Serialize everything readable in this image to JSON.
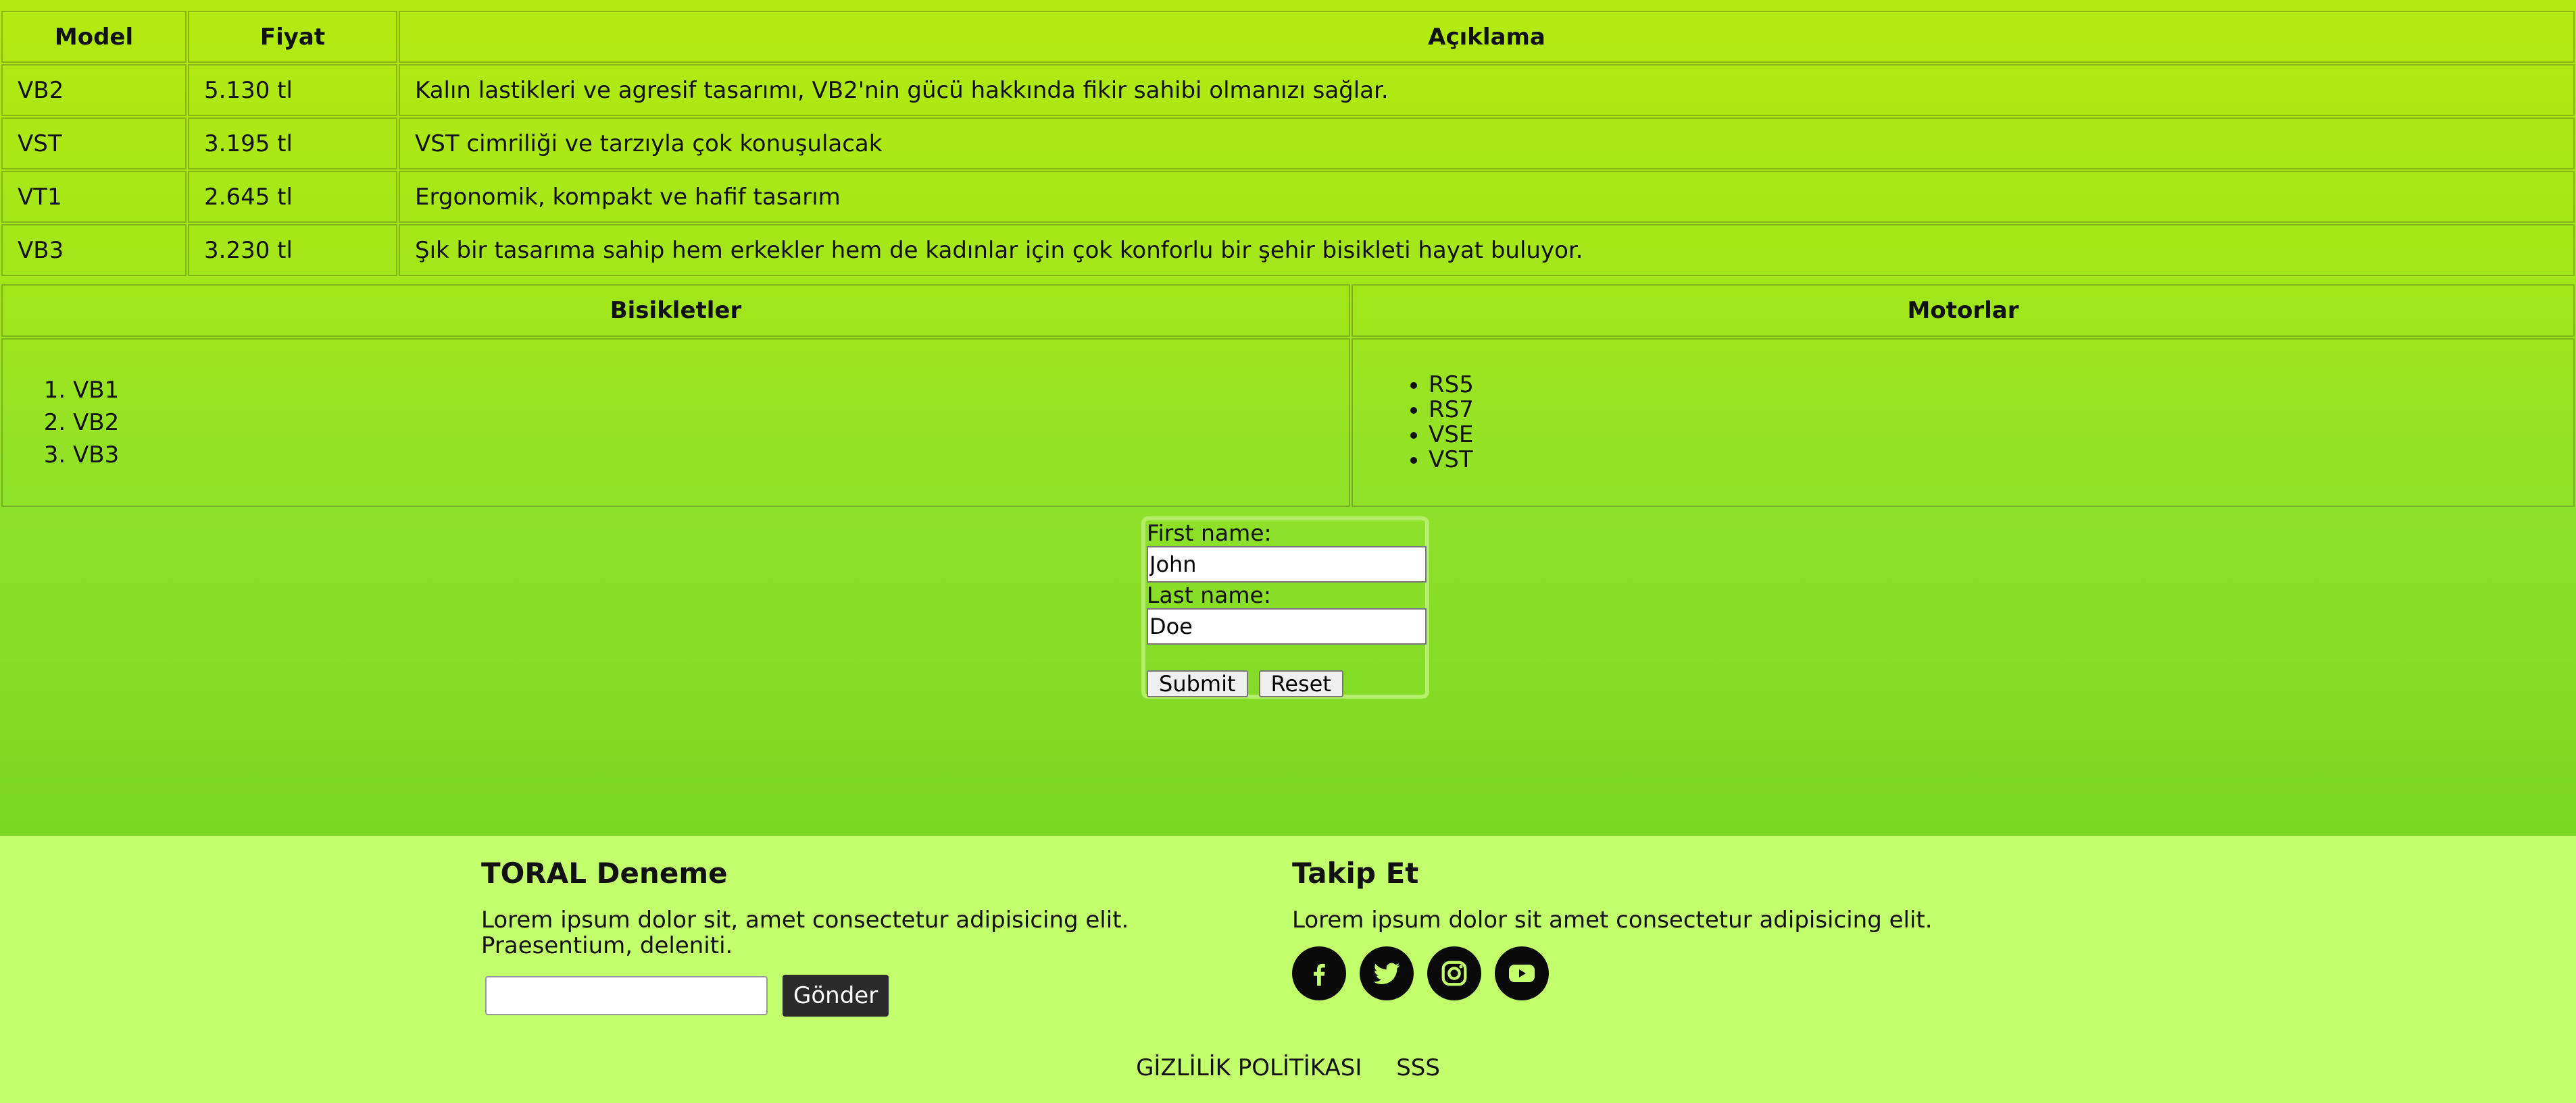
{
  "products_table": {
    "headers": [
      "Model",
      "Fiyat",
      "Açıklama"
    ],
    "rows": [
      [
        "VB2",
        "5.130 tl",
        "Kalın lastikleri ve agresif tasarımı, VB2'nin gücü hakkında fikir sahibi olmanızı sağlar."
      ],
      [
        "VST",
        "3.195 tl",
        "VST cimriliği ve tarzıyla çok konuşulacak"
      ],
      [
        "VT1",
        "2.645 tl",
        "Ergonomik, kompakt ve hafif tasarım"
      ],
      [
        "VB3",
        "3.230 tl",
        "Şık bir tasarıma sahip hem erkekler hem de kadınlar için çok konforlu bir şehir bisikleti hayat buluyor."
      ]
    ]
  },
  "categories_table": {
    "headers": [
      "Bisikletler",
      "Motorlar"
    ],
    "bicycles": [
      "VB1",
      "VB2",
      "VB3"
    ],
    "motors": [
      "RS5",
      "RS7",
      "VSE",
      "VST"
    ]
  },
  "form": {
    "first_name_label": "First name:",
    "first_name_value": "John",
    "last_name_label": "Last name:",
    "last_name_value": "Doe",
    "submit_label": "Submit",
    "reset_label": "Reset"
  },
  "footer": {
    "brand_title": "TORAL Deneme",
    "brand_text": "Lorem ipsum dolor sit, amet consectetur adipisicing elit. Praesentium, deleniti.",
    "newsletter_value": "",
    "send_label": "Gönder",
    "follow_title": "Takip Et",
    "follow_text": "Lorem ipsum dolor sit amet consectetur adipisicing elit.",
    "social_icons": [
      "facebook-icon",
      "twitter-icon",
      "instagram-icon",
      "youtube-icon"
    ],
    "links": [
      "GİZLİLİK POLİTİKASI",
      "SSS"
    ]
  },
  "colors": {
    "main_gradient_top": "#b4ea11",
    "main_gradient_bottom": "#7bd722",
    "footer_bg": "#c3fe6d",
    "send_button_bg": "#2b2b2b",
    "social_icon_bg": "#0a0a0a"
  }
}
